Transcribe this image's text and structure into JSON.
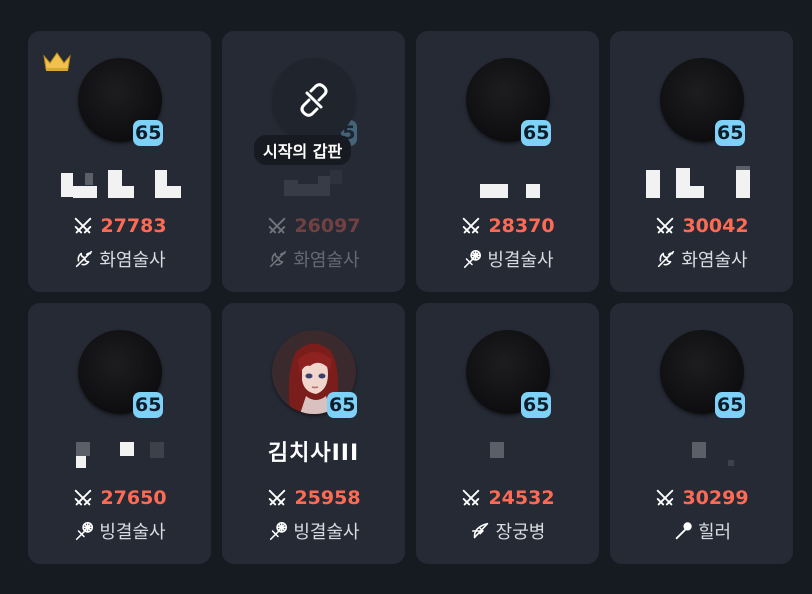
{
  "colors": {
    "background": "#161b22",
    "card": "#252a35",
    "level_badge": "#7fd2f7",
    "power_text": "#ff6a55",
    "class_text": "#d8dbe0"
  },
  "tooltip_unlinked": "시작의 갑판",
  "cards": [
    {
      "level": "65",
      "name": "",
      "power": "27783",
      "class": "화염술사",
      "class_icon": "fire-mage-icon",
      "leader": true,
      "disabled": false
    },
    {
      "level": "65",
      "name": "",
      "power": "26097",
      "class": "화염술사",
      "class_icon": "fire-mage-icon",
      "leader": false,
      "disabled": true
    },
    {
      "level": "65",
      "name": "",
      "power": "28370",
      "class": "빙결술사",
      "class_icon": "ice-mage-icon",
      "leader": false,
      "disabled": false
    },
    {
      "level": "65",
      "name": "",
      "power": "30042",
      "class": "화염술사",
      "class_icon": "fire-mage-icon",
      "leader": false,
      "disabled": false
    },
    {
      "level": "65",
      "name": "",
      "power": "27650",
      "class": "빙결술사",
      "class_icon": "ice-mage-icon",
      "leader": false,
      "disabled": false
    },
    {
      "level": "65",
      "name": "김치사III",
      "power": "25958",
      "class": "빙결술사",
      "class_icon": "ice-mage-icon",
      "leader": false,
      "disabled": false
    },
    {
      "level": "65",
      "name": "",
      "power": "24532",
      "class": "장궁병",
      "class_icon": "longbow-icon",
      "leader": false,
      "disabled": false
    },
    {
      "level": "65",
      "name": "",
      "power": "30299",
      "class": "힐러",
      "class_icon": "healer-icon",
      "leader": false,
      "disabled": false
    }
  ]
}
